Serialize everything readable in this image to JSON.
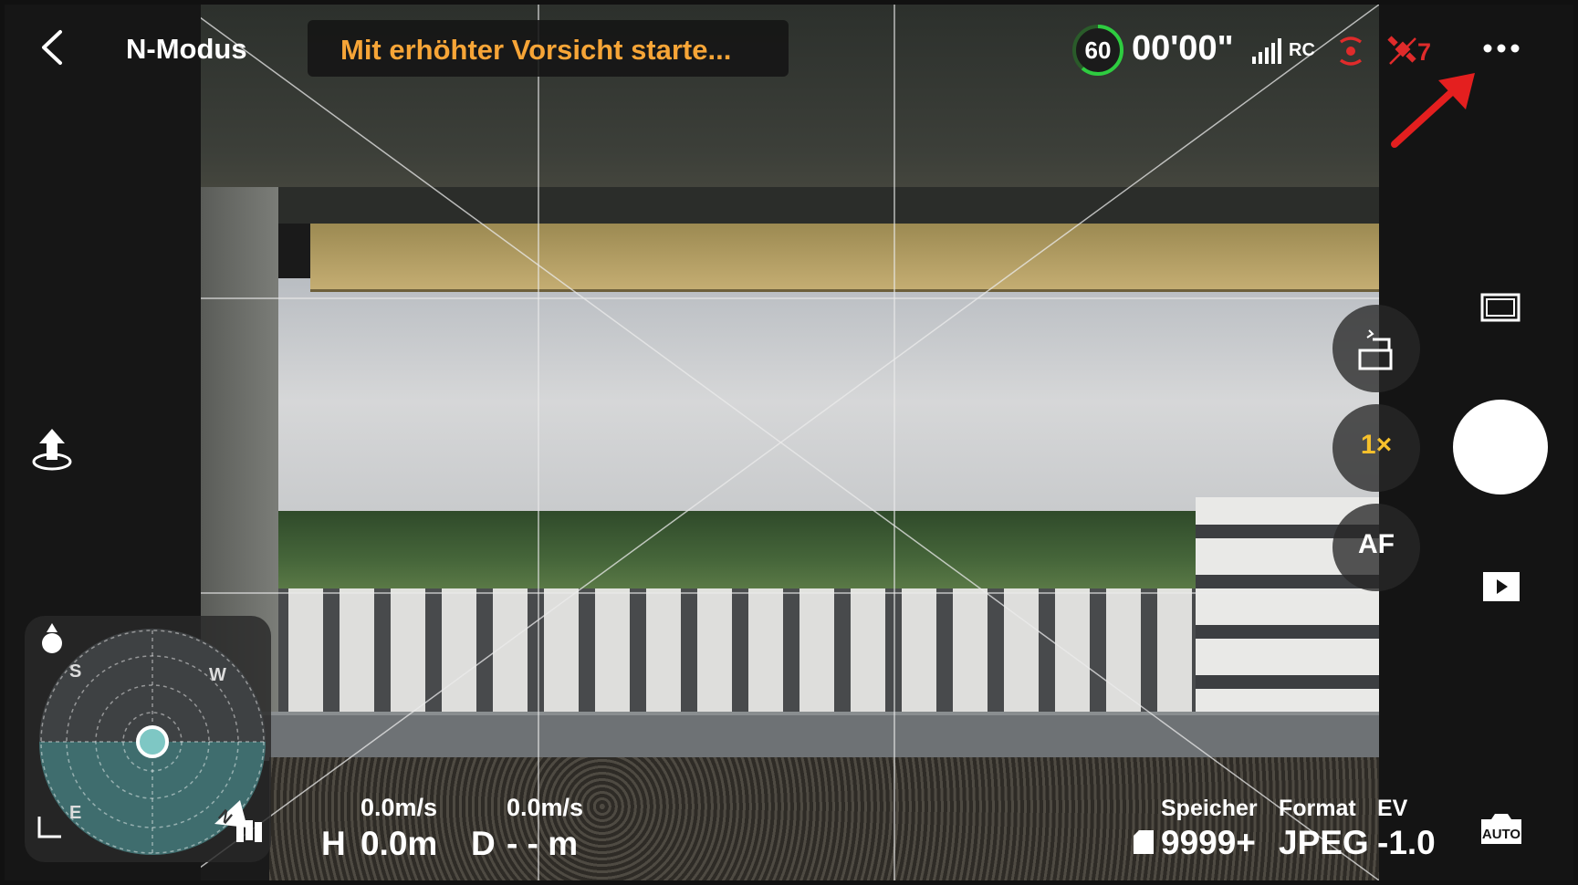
{
  "topbar": {
    "mode": "N-Modus",
    "warning": "Mit erhöhter Vorsicht starte...",
    "battery": "60",
    "timer": "00'00\"",
    "rc_label": "RC",
    "satellite_count": "7"
  },
  "camera_buttons": {
    "zoom": "1×",
    "focus": "AF"
  },
  "radar": {
    "directions": {
      "s": "S",
      "w": "W",
      "e": "E",
      "n": "N"
    }
  },
  "telemetry": {
    "horizontal_speed": "0.0m/s",
    "vertical_speed": "0.0m/s",
    "height_label": "H",
    "height": "0.0m",
    "distance_label": "D",
    "distance": "- - m"
  },
  "photo_info": {
    "storage_label": "Speicher",
    "storage_value": "9999+",
    "format_label": "Format",
    "format_value": "JPEG",
    "ev_label": "EV",
    "ev_value": "-1.0"
  },
  "colors": {
    "warning": "#f7a537",
    "battery_ring": "#2ecc40",
    "alert_red": "#e02b2b",
    "zoom_yellow": "#f6c02c"
  },
  "icons": [
    "back-icon",
    "signal-icon",
    "vision-sensor-icon",
    "satellite-icon",
    "more-icon",
    "takeoff-icon",
    "aspect-ratio-icon",
    "playback-icon",
    "auto-mode-icon",
    "map-icon",
    "home-point-icon",
    "camera-switch-icon"
  ]
}
